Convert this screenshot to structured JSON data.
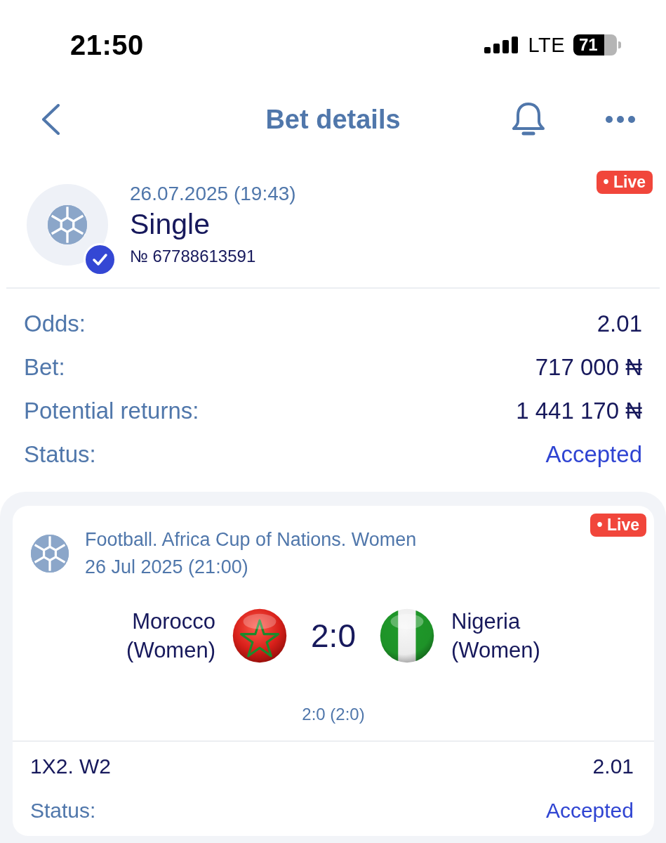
{
  "status_bar": {
    "time": "21:50",
    "network": "LTE",
    "battery": "71"
  },
  "nav": {
    "title": "Bet details"
  },
  "bet": {
    "datetime": "26.07.2025 (19:43)",
    "type": "Single",
    "number": "№ 67788613591",
    "badge": "• Live",
    "confirmed": true
  },
  "summary": [
    {
      "label": "Odds:",
      "value": "2.01",
      "kind": "amount"
    },
    {
      "label": "Bet:",
      "value": "717 000 ₦",
      "kind": "amount"
    },
    {
      "label": "Potential returns:",
      "value": "1 441 170 ₦",
      "kind": "amount"
    },
    {
      "label": "Status:",
      "value": "Accepted",
      "kind": "status"
    }
  ],
  "event": {
    "badge": "• Live",
    "tournament": "Football. Africa Cup of Nations. Women",
    "start": "26 Jul 2025 (21:00)",
    "home": "Morocco (Women)",
    "score": "2:0",
    "away": "Nigeria (Women)",
    "period_score": "2:0 (2:0)"
  },
  "selection": [
    {
      "label": "1X2. W2",
      "value": "2.01",
      "kind": "pick"
    },
    {
      "label": "Status:",
      "value": "Accepted",
      "kind": "status"
    }
  ]
}
